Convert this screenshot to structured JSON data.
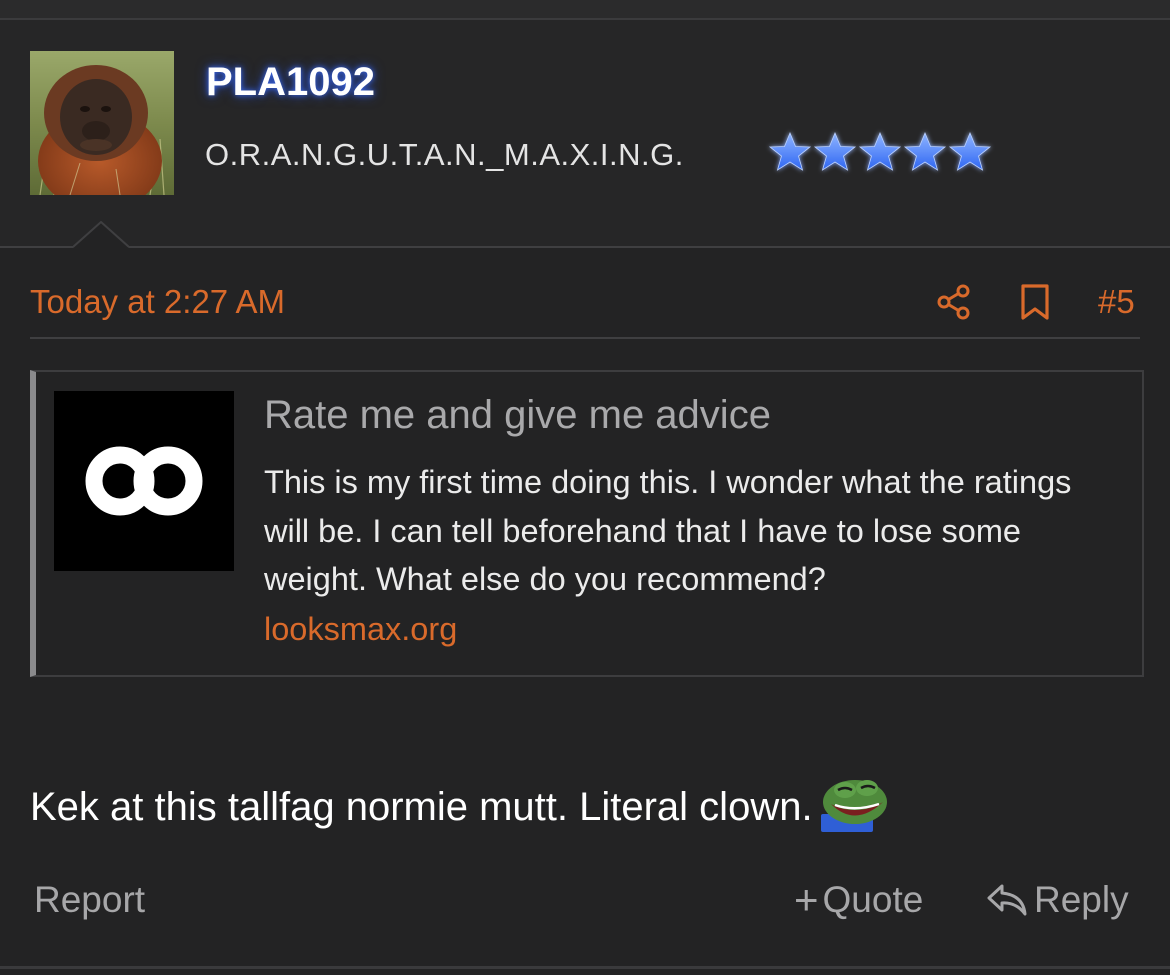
{
  "user": {
    "username": "PLA1092",
    "title": "O.R.A.N.G.U.T.A.N._M.A.X.I.N.G.",
    "star_rating": 5,
    "avatar": "orangutan-photo"
  },
  "post": {
    "date": "Today at 2:27 AM",
    "number": "#5",
    "body": "Kek at this tallfag normie mutt. Literal clown.",
    "emoji": "laughing-pepe"
  },
  "embed": {
    "title": "Rate me and give me advice",
    "description": "This is my first time doing this. I wonder what the ratings will be. I can tell beforehand that I have to lose some weight. What else do you recommend?",
    "link": "looksmax.org",
    "logo": "infinity-logo"
  },
  "actions": {
    "report": "Report",
    "quote": "Quote",
    "reply": "Reply"
  },
  "colors": {
    "accent": "#d96a2b",
    "background": "#232324",
    "muted": "#a7a7a9",
    "star": "#3f7bff"
  }
}
